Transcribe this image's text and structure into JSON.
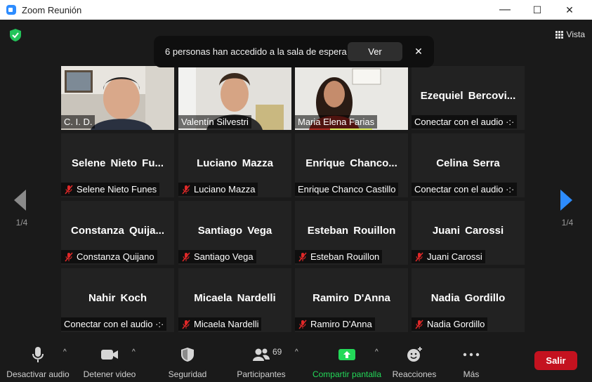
{
  "window": {
    "title": "Zoom Reunión",
    "minimize": "—",
    "maximize": "☐",
    "close": "✕"
  },
  "topbar": {
    "view_label": "Vista"
  },
  "notification": {
    "message": "6 personas han accedido a la sala de espera",
    "button": "Ver",
    "close": "✕"
  },
  "pagination": {
    "left": "1/4",
    "right": "1/4"
  },
  "tiles": [
    {
      "label": "C. I. D."
    },
    {
      "label": "Valentín Silvestri"
    },
    {
      "label": "Maria Elena Farias"
    },
    {
      "big": "Ezequiel  Bercovi...",
      "label": "Conectar con el audio ·:·"
    },
    {
      "big": "Selene  Nieto  Fu...",
      "label": "Selene Nieto Funes"
    },
    {
      "big": "Luciano Mazza",
      "label": "Luciano Mazza"
    },
    {
      "big": "Enrique  Chanco...",
      "label": "Enrique Chanco Castillo"
    },
    {
      "big": "Celina Serra",
      "label": "Conectar con el audio ·:·"
    },
    {
      "big": "Constanza  Quija...",
      "label": "Constanza Quijano"
    },
    {
      "big": "Santiago Vega",
      "label": "Santiago Vega"
    },
    {
      "big": "Esteban Rouillon",
      "label": "Esteban Rouillon"
    },
    {
      "big": "Juani Carossi",
      "label": "Juani Carossi"
    },
    {
      "big": "Nahir Koch",
      "label": "Conectar con el audio ·:·"
    },
    {
      "big": "Micaela Nardelli",
      "label": "Micaela Nardelli"
    },
    {
      "big": "Ramiro D'Anna",
      "label": "Ramiro D'Anna"
    },
    {
      "big": "Nadia Gordillo",
      "label": "Nadia Gordillo"
    }
  ],
  "toolbar": {
    "mute": "Desactivar audio",
    "video": "Detener video",
    "security": "Seguridad",
    "participants": "Participantes",
    "participants_count": "69",
    "share": "Compartir pantalla",
    "reactions": "Reacciones",
    "more": "Más",
    "leave": "Salir",
    "caret": "^"
  },
  "colors": {
    "accent_blue": "#2d8cff",
    "share_green": "#23d959",
    "active_speaker": "#e2f25b",
    "leave_red": "#c4121f",
    "muted_red": "#e02828"
  }
}
